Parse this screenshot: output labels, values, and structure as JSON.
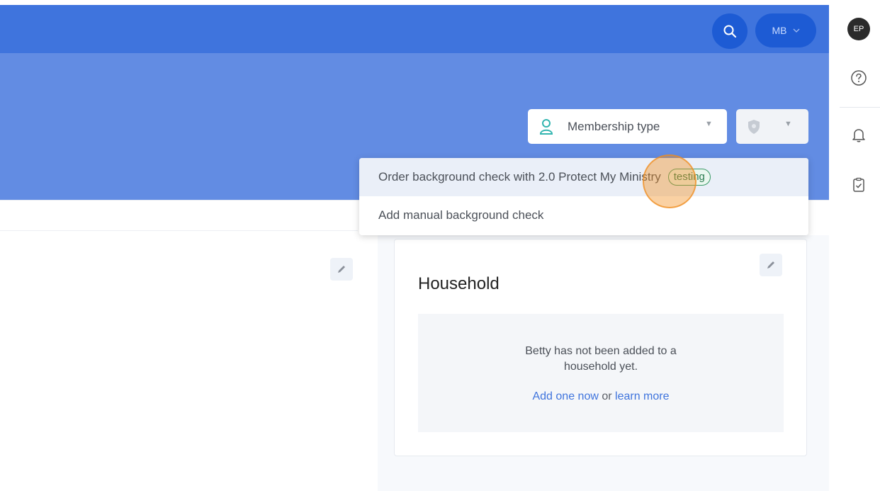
{
  "topbar": {
    "user_menu_label": "MB"
  },
  "profile_actions": {
    "membership_type_label": "Membership type"
  },
  "dropdown": {
    "items": [
      {
        "label": "Order background check with 2.0 Protect My Ministry",
        "badge": "testing"
      },
      {
        "label": "Add manual background check"
      }
    ]
  },
  "household": {
    "title": "Household",
    "empty_line1": "Betty has not been added to a",
    "empty_line2": "household yet.",
    "add_link": "Add one now",
    "or_text": " or ",
    "learn_link": "learn more"
  },
  "rail": {
    "avatar_initials": "EP"
  },
  "colors": {
    "topbar": "#3f74dd",
    "header": "#628ce3",
    "accent": "#3f74dd",
    "badge_green": "#2e7d52",
    "click_indicator": "#f49224"
  },
  "icons": [
    "search-icon",
    "chevron-down-icon",
    "person-icon",
    "shield-icon",
    "edit-pencil-icon",
    "help-icon",
    "bell-icon",
    "clipboard-check-icon"
  ]
}
